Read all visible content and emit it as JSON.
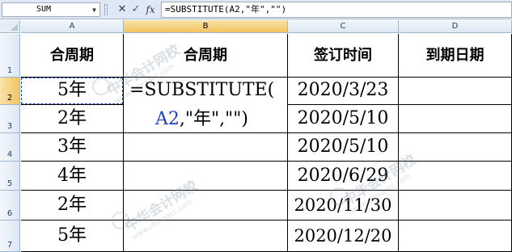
{
  "formula_bar": {
    "name_box": "SUM",
    "cancel_icon": "✕",
    "enter_icon": "✓",
    "fx_label": "fx",
    "formula": "=SUBSTITUTE(A2,\"年\",\"\")"
  },
  "columns": [
    "A",
    "B",
    "C",
    "D"
  ],
  "rows": [
    "1",
    "2",
    "3",
    "4",
    "5",
    "6",
    "7"
  ],
  "headers": {
    "a": "合周期",
    "b": "合周期",
    "c": "签订时间",
    "d": "到期日期"
  },
  "cycles": [
    "5年",
    "2年",
    "3年",
    "4年",
    "2年",
    "5年"
  ],
  "sign_dates": [
    "2020/3/23",
    "2020/5/10",
    "2020/5/10",
    "2020/6/29",
    "2020/11/30",
    "2020/12/20"
  ],
  "editing_cell": {
    "line1": "=SUBSTITUTE(",
    "ref": "A2",
    "rest": ",\"年\",\"\")"
  },
  "watermark": {
    "text": "中华会计网校",
    "url": "www.chinaacc.com"
  },
  "colors": {
    "reference_blue": "#1f3fbf",
    "selected_header": "#f2c45f"
  }
}
